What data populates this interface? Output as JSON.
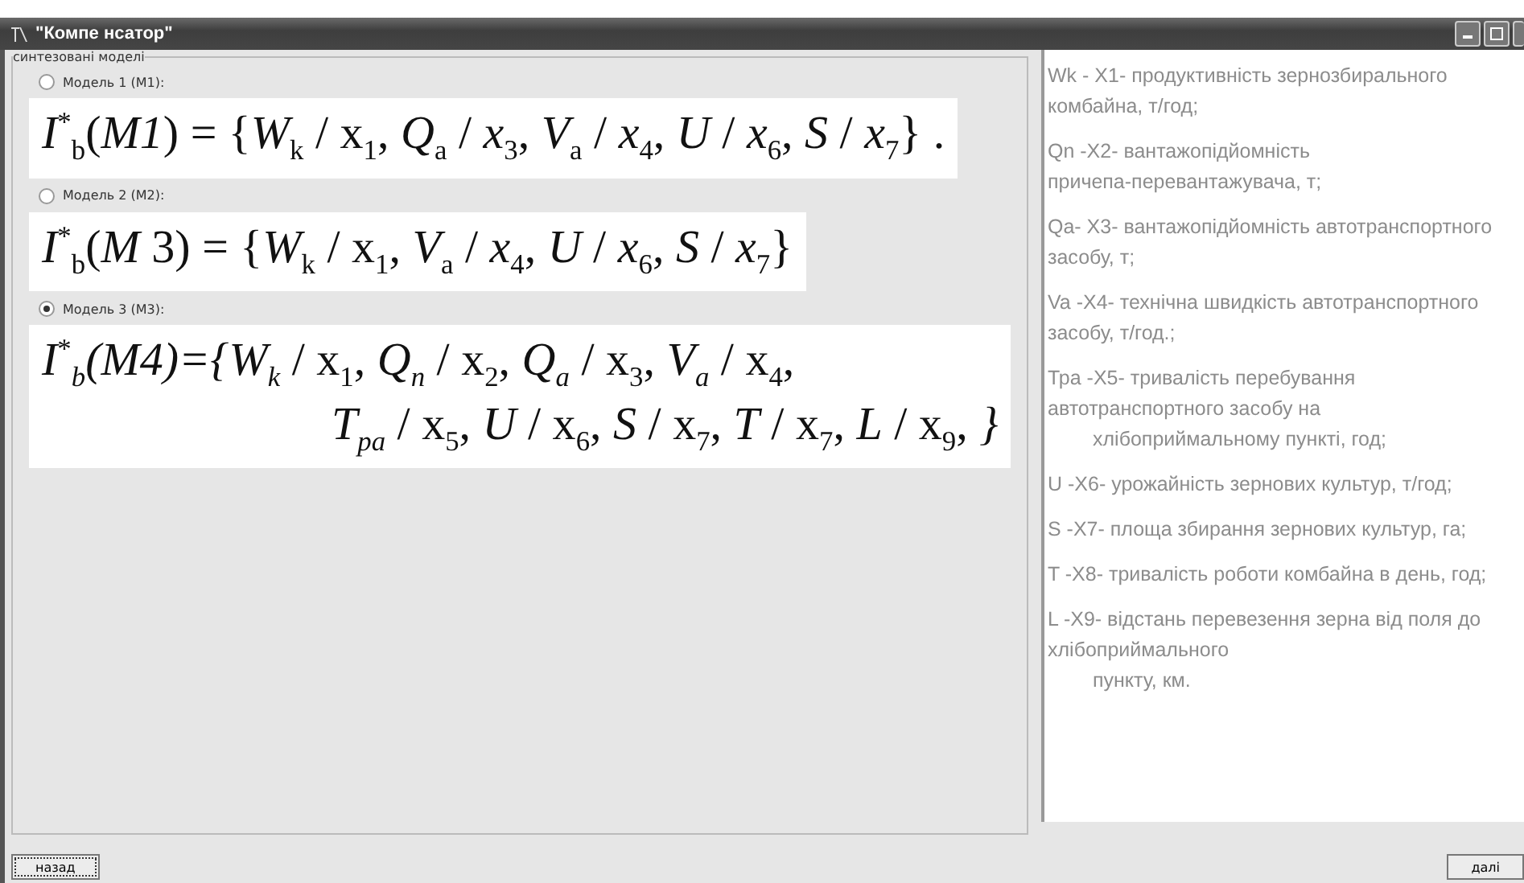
{
  "window": {
    "title": "\"Компе нсатор\""
  },
  "group": {
    "legend": "синтезовані моделі"
  },
  "models": [
    {
      "label": "Модель 1 (М1):",
      "selected": false,
      "formula": [
        "*I*$^{*}$$_{b}$(*M1*) = {*W*$_{k}$ / x$_{1}$, *Q*$_{a}$ / *x*$_{3}$, *V*$_{a}$ / *x*$_{4}$, *U* / *x*$_{6}$,  *S* / *x*$_{7}$} ."
      ]
    },
    {
      "label": "Модель 2 (М2):",
      "selected": false,
      "formula": [
        "*I*$^{*}$$_{b}$(*M* 3) = {*W*$_{k}$ / x$_{1}$, *V*$_{a}$ / *x*$_{4}$, *U* / *x*$_{6}$,  *S* / *x*$_{7}$}"
      ]
    },
    {
      "label": "Модель 3 (М3):",
      "selected": true,
      "formula": [
        "*I*$^{*}$*$_{b}$(M4)={W$_{k}$* / x$_{1}$, *Q$_{n}$* / x$_{2}$, *Q$_{a}$* / x$_{3}$, *V$_{a}$* / x$_{4}$,",
        "*T$_{pa}$* / x$_{5}$, *U* / x$_{6}$, *S* / x$_{7}$, *T* / x$_{7}$, *L* / x$_{9}$, *}*"
      ]
    }
  ],
  "legend_items": [
    {
      "lines": [
        {
          "text": "Wk - X1- продуктивність зернозбирального",
          "indent": false
        },
        {
          "text": "комбайна, т/год;",
          "indent": false
        }
      ]
    },
    {
      "lines": [
        {
          "text": "Qn -X2- вантажопідйомність",
          "indent": false
        },
        {
          "text": "причепа-перевантажувача, т;",
          "indent": false
        }
      ]
    },
    {
      "lines": [
        {
          "text": "Qa- X3- вантажопідйомність автотранспортного",
          "indent": false
        },
        {
          "text": "засобу, т;",
          "indent": false
        }
      ]
    },
    {
      "lines": [
        {
          "text": "Va -X4- технічна швидкість автотранспортного",
          "indent": false
        },
        {
          "text": "засобу, т/год.;",
          "indent": false
        }
      ]
    },
    {
      "lines": [
        {
          "text": "Тра -X5- тривалість перебування",
          "indent": false
        },
        {
          "text": "автотранспортного засобу на",
          "indent": false
        },
        {
          "text": "хлібоприймальному пункті, год;",
          "indent": true
        }
      ]
    },
    {
      "lines": [
        {
          "text": "U -X6- урожайність зернових культур, т/год;",
          "indent": false
        }
      ]
    },
    {
      "lines": [
        {
          "text": "S -X7- площа збирання зернових культур, га;",
          "indent": false
        }
      ]
    },
    {
      "lines": [
        {
          "text": "T -X8- тривалість роботи комбайна в день, год;",
          "indent": false
        }
      ]
    },
    {
      "lines": [
        {
          "text": "L -X9- відстань перевезення зерна від поля до",
          "indent": false
        },
        {
          "text": "хлібоприймального",
          "indent": false
        },
        {
          "text": "пункту, км.",
          "indent": true
        }
      ]
    }
  ],
  "buttons": {
    "back": "назад",
    "next": "далі"
  }
}
